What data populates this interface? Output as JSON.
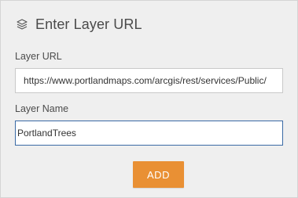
{
  "panel": {
    "title": "Enter Layer URL",
    "title_icon": "layers-icon"
  },
  "form": {
    "url_label": "Layer URL",
    "url_value": "https://www.portlandmaps.com/arcgis/rest/services/Public/",
    "name_label": "Layer Name",
    "name_value": "PortlandTrees"
  },
  "actions": {
    "add_label": "ADD"
  },
  "colors": {
    "accent": "#e99034",
    "focus_border": "#3a6aa5",
    "panel_bg": "#efefef"
  }
}
